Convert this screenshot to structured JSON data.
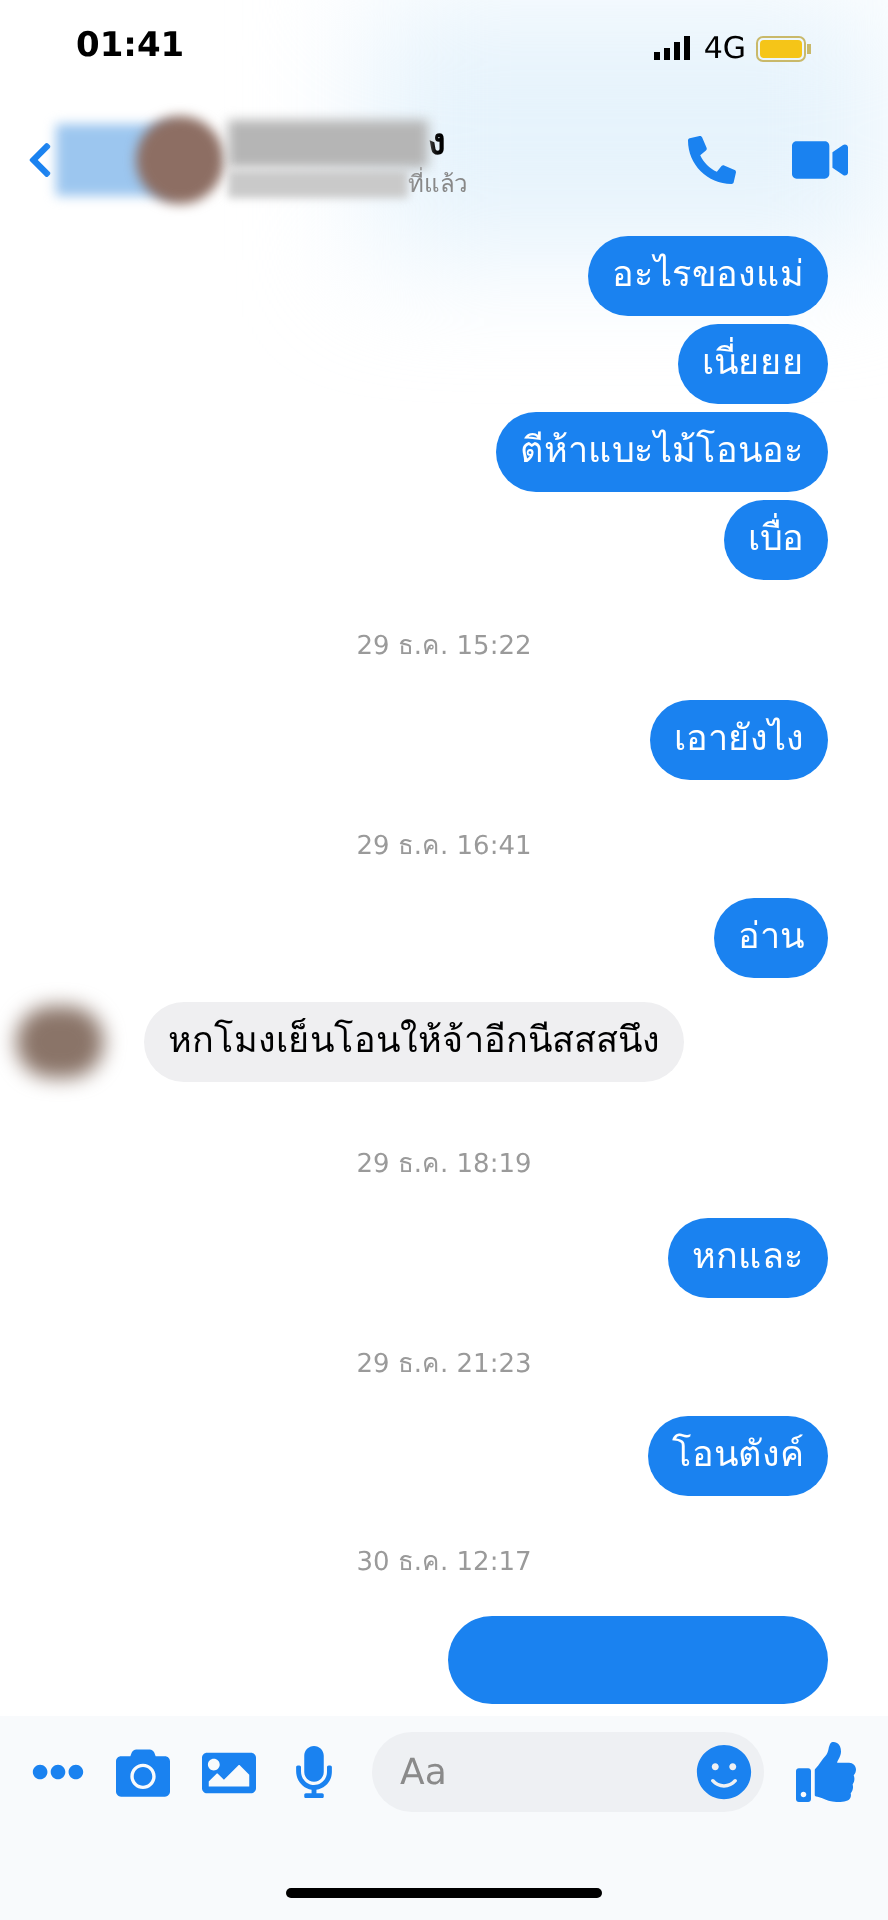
{
  "status_bar": {
    "time": "01:41",
    "network": "4G"
  },
  "header": {
    "name_end": "ง",
    "status_end": "ที่แล้ว"
  },
  "messages": [
    {
      "kind": "sent",
      "text": "อะไรของแม่"
    },
    {
      "kind": "sent",
      "text": "เนี่ยยย"
    },
    {
      "kind": "sent",
      "text": "ตีห้าแบะไม้โอนอะ"
    },
    {
      "kind": "sent",
      "text": "เบื่อ"
    },
    {
      "kind": "timestamp",
      "text": "29 ธ.ค. 15:22"
    },
    {
      "kind": "sent",
      "text": "เอายังไง"
    },
    {
      "kind": "timestamp",
      "text": "29 ธ.ค. 16:41"
    },
    {
      "kind": "sent",
      "text": "อ่าน"
    },
    {
      "kind": "received",
      "text": "หกโมงเย็นโอนให้จ้าอีกนีสสสนึง"
    },
    {
      "kind": "timestamp",
      "text": "29 ธ.ค. 18:19"
    },
    {
      "kind": "sent",
      "text": "หกและ"
    },
    {
      "kind": "timestamp",
      "text": "29 ธ.ค. 21:23"
    },
    {
      "kind": "sent",
      "text": "โอนตังค์"
    },
    {
      "kind": "timestamp",
      "text": "30 ธ.ค. 12:17"
    },
    {
      "kind": "hidden_sent"
    }
  ],
  "composer": {
    "placeholder": "Aa"
  }
}
